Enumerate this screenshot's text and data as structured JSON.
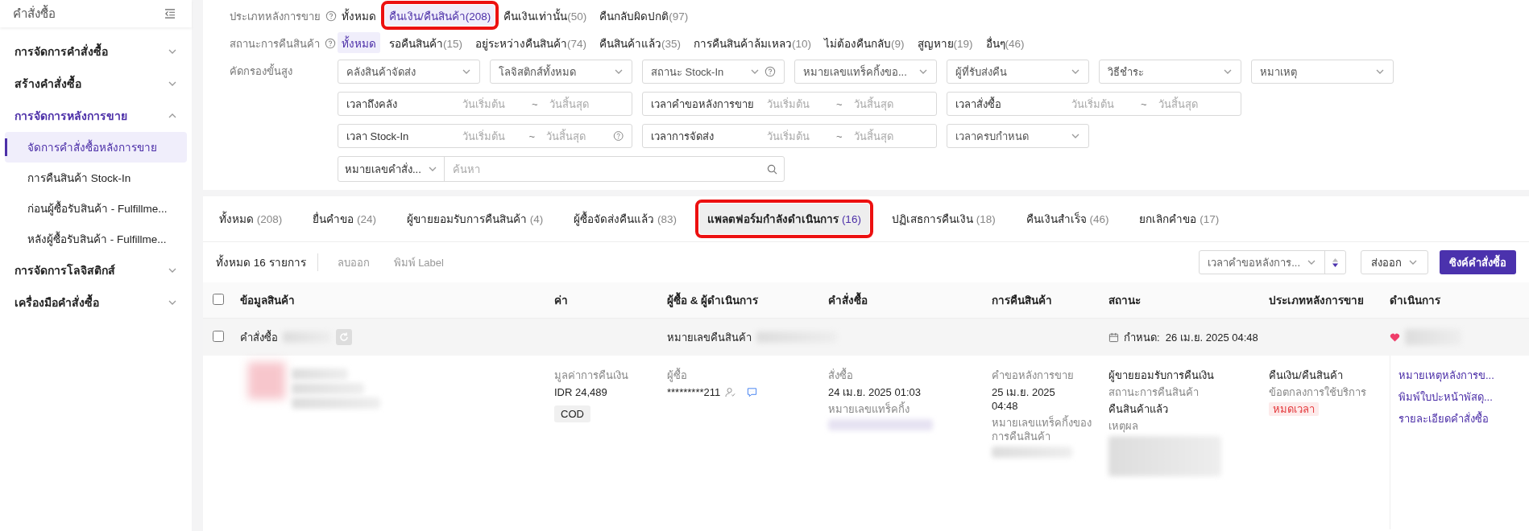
{
  "sidebar": {
    "title": "คำสั่งซื้อ",
    "groups": [
      {
        "label": "การจัดการคำสั่งซื้อ",
        "expanded": false
      },
      {
        "label": "สร้างคำสั่งซื้อ",
        "expanded": false
      },
      {
        "label": "การจัดการหลังการขาย",
        "expanded": true,
        "children": [
          {
            "label": "จัดการคำสั่งซื้อหลังการขาย",
            "selected": true
          },
          {
            "label": "การคืนสินค้า Stock-In",
            "selected": false
          },
          {
            "label": "ก่อนผู้ซื้อรับสินค้า - Fulfillme...",
            "selected": false
          },
          {
            "label": "หลังผู้ซื้อรับสินค้า - Fulfillme...",
            "selected": false
          }
        ]
      },
      {
        "label": "การจัดการโลจิสติกส์",
        "expanded": false
      },
      {
        "label": "เครื่องมือคำสั่งซื้อ",
        "expanded": false
      }
    ]
  },
  "filters": {
    "option_rows": [
      {
        "label": "ประเภทหลังการขาย",
        "options": [
          {
            "label": "ทั้งหมด",
            "selected": false,
            "highlighted": false
          },
          {
            "label": "คืนเงิน/คืนสินค้า",
            "count": "(208)",
            "selected": true,
            "highlighted": true
          },
          {
            "label": "คืนเงินเท่านั้น",
            "count": "(50)",
            "selected": false,
            "highlighted": false
          },
          {
            "label": "คืนกลับผิดปกติ",
            "count": "(97)",
            "selected": false,
            "highlighted": false
          }
        ]
      },
      {
        "label": "สถานะการคืนสินค้า",
        "options": [
          {
            "label": "ทั้งหมด",
            "selected": true,
            "highlighted": false
          },
          {
            "label": "รอคืนสินค้า",
            "count": "(15)",
            "selected": false,
            "highlighted": false
          },
          {
            "label": "อยู่ระหว่างคืนสินค้า",
            "count": "(74)",
            "selected": false,
            "highlighted": false
          },
          {
            "label": "คืนสินค้าแล้ว",
            "count": "(35)",
            "selected": false,
            "highlighted": false
          },
          {
            "label": "การคืนสินค้าล้มเหลว",
            "count": "(10)",
            "selected": false,
            "highlighted": false
          },
          {
            "label": "ไม่ต้องคืนกลับ",
            "count": "(9)",
            "selected": false,
            "highlighted": false
          },
          {
            "label": "สูญหาย",
            "count": "(19)",
            "selected": false,
            "highlighted": false
          },
          {
            "label": "อื่นๆ",
            "count": "(46)",
            "selected": false,
            "highlighted": false
          }
        ]
      }
    ],
    "advanced": {
      "label": "คัดกรองขั้นสูง",
      "fields": [
        {
          "kind": "select",
          "placeholder": "คลังสินค้าจัดส่ง"
        },
        {
          "kind": "select",
          "placeholder": "โลจิสติกส์ทั้งหมด"
        },
        {
          "kind": "select",
          "placeholder": "สถานะ Stock-In",
          "help": true
        },
        {
          "kind": "select",
          "placeholder": "หมายเลขแทร็คกิ้งขอ..."
        },
        {
          "kind": "select",
          "placeholder": "ผู้ที่รับส่งคืน"
        },
        {
          "kind": "select",
          "placeholder": "วิธีชำระ"
        },
        {
          "kind": "select",
          "placeholder": "หมาเหตุ"
        },
        {
          "kind": "date_range",
          "label": "เวลาถึงคลัง",
          "start": "วันเริ่มต้น",
          "separator": "~",
          "end": "วันสิ้นสุด"
        },
        {
          "kind": "date_range",
          "label": "เวลาคำขอหลังการขาย",
          "start": "วันเริ่มต้น",
          "separator": "~",
          "end": "วันสิ้นสุด"
        },
        {
          "kind": "date_range",
          "label": "เวลาสั่งซื้อ",
          "start": "วันเริ่มต้น",
          "separator": "~",
          "end": "วันสิ้นสุด"
        },
        {
          "kind": "date_range",
          "label": "เวลา Stock-In",
          "start": "วันเริ่มต้น",
          "separator": "~",
          "end": "วันสิ้นสุด",
          "help": true
        },
        {
          "kind": "date_range",
          "label": "เวลาการจัดส่ง",
          "start": "วันเริ่มต้น",
          "separator": "~",
          "end": "วันสิ้นสุด"
        },
        {
          "kind": "select",
          "placeholder": "เวลาครบกำหนด"
        },
        {
          "kind": "search",
          "scope": "หมายเลขคำสั่ง...",
          "placeholder": "ค้นหา"
        }
      ]
    }
  },
  "tabs": [
    {
      "label": "ทั้งหมด",
      "count": "(208)",
      "selected": false,
      "highlighted": false
    },
    {
      "label": "ยื่นคำขอ",
      "count": "(24)",
      "selected": false,
      "highlighted": false
    },
    {
      "label": "ผู้ขายยอมรับการคืนสินค้า",
      "count": "(4)",
      "selected": false,
      "highlighted": false
    },
    {
      "label": "ผู้ซื้อจัดส่งคืนแล้ว",
      "count": "(83)",
      "selected": false,
      "highlighted": false
    },
    {
      "label": "แพลตฟอร์มกำลังดำเนินการ",
      "count": "(16)",
      "selected": true,
      "highlighted": true
    },
    {
      "label": "ปฏิเสธการคืนเงิน",
      "count": "(18)",
      "selected": false,
      "highlighted": false
    },
    {
      "label": "คืนเงินสำเร็จ",
      "count": "(46)",
      "selected": false,
      "highlighted": false
    },
    {
      "label": "ยกเลิกคำขอ",
      "count": "(17)",
      "selected": false,
      "highlighted": false
    }
  ],
  "toolbar": {
    "total": "ทั้งหมด 16 รายการ",
    "actions": [
      "ลบออก",
      "พิมพ์ Label"
    ],
    "sort": "เวลาคำขอหลังการ...",
    "export": "ส่งออก",
    "sync": "ซิงค์คำสั่งซื้อ"
  },
  "table": {
    "select_all": {
      "checked": false
    },
    "columns": [
      "ข้อมูลสินค้า",
      "ค่า",
      "ผู้ซื้อ & ผู้ดำเนินการ",
      "คำสั่งซื้อ",
      "การคืนสินค้า",
      "สถานะ",
      "ประเภทหลังการขาย",
      "ดำเนินการ"
    ],
    "rows": [
      {
        "checked": false,
        "order_label": "คำสั่งซื้อ",
        "return_label": "หมายเลขคืนสินค้า",
        "due": "กำหนด:  26 เม.ย. 2025 04:48",
        "refund_label": "มูลค่าการคืนเงิน",
        "refund": "IDR 24,489",
        "payment": "COD",
        "buyer_label": "ผู้ซื้อ",
        "buyer": "*********211",
        "ordered_label": "สั่งซื้อ",
        "ordered": "24 เม.ย. 2025 01:03",
        "tracking_label": "หมายเลขแทร็คกิ้ง",
        "request_label": "คำขอหลังการขาย",
        "request_time": "25 เม.ย. 2025 04:48",
        "return_tracking_label": "หมายเลขแทร็คกิ้งของการคืนสินค้า",
        "status": "ผู้ขายยอมรับการคืนเงิน",
        "return_status_label": "สถานะการคืนสินค้า",
        "return_status": "คืนสินค้าแล้ว",
        "reason_label": "เหตุผล",
        "type": "คืนเงิน/คืนสินค้า",
        "terms_label": "ข้อตกลงการใช้บริการ",
        "terms_tag": "หมดเวลา",
        "actions": [
          "หมายเหตุหลังการข...",
          "พิมพ์ใบปะหน้าพัสดุ...",
          "รายละเอียดคำสั่งซื้อ"
        ]
      }
    ]
  }
}
